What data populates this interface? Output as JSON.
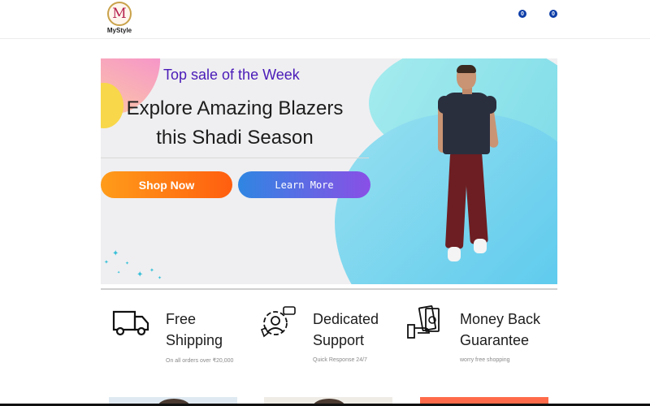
{
  "header": {
    "logo_letter": "M",
    "logo_text": "MyStyle",
    "wishlist_count": "0",
    "cart_count": "0"
  },
  "banner": {
    "kicker": "Top sale of the Week",
    "title_line1": "Explore Amazing Blazers",
    "title_line2": "this Shadi Season",
    "shop_button": "Shop Now",
    "learn_button": "Learn More"
  },
  "features": [
    {
      "icon": "truck-icon",
      "title_line1": "Free",
      "title_line2": "Shipping",
      "subtitle": "On all orders over ₹20,000"
    },
    {
      "icon": "support-agent-icon",
      "title_line1": "Dedicated",
      "title_line2": "Support",
      "subtitle": "Quick Response 24/7"
    },
    {
      "icon": "money-hand-icon",
      "title_line1": "Money Back",
      "title_line2": "Guarantee",
      "subtitle": "worry free shopping"
    }
  ],
  "colors": {
    "brand_accent": "#4a1bb8",
    "shop_gradient": [
      "#ff9c1a",
      "#ff5e0f"
    ],
    "learn_gradient": [
      "#2f86e2",
      "#8a4fe6"
    ],
    "badge": "#0d3ea8"
  }
}
